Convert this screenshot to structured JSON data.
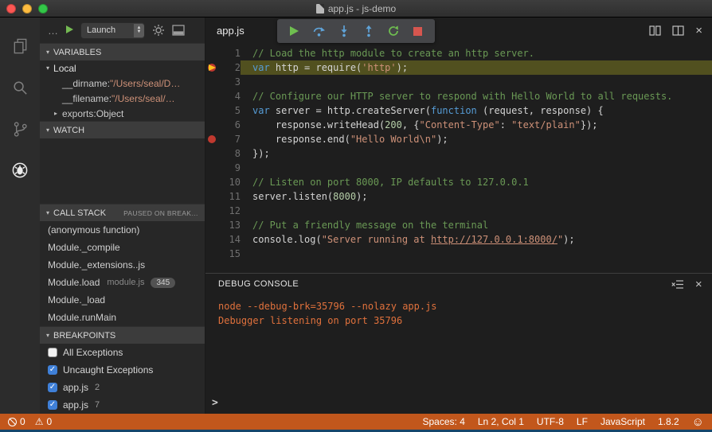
{
  "icons": {
    "close": "×",
    "warning": "⚠",
    "smiley": "☺",
    "twisty_open": "▾",
    "twisty_closed": "▸",
    "check": "✓",
    "select_up": "▲",
    "select_down": "▼"
  },
  "colors": {
    "status_bar": "#c2571c",
    "breakpoint_red": "#c0392f",
    "debug_line_highlight": "#51501f",
    "console_text": "#e0713c"
  },
  "window": {
    "title": "app.js - js-demo"
  },
  "sidebar": {
    "toolbar": {
      "overflow": "…",
      "config": "Launch"
    },
    "variables": {
      "header": "VARIABLES",
      "scope": "Local",
      "items": [
        {
          "name": "__dirname",
          "value": "\"/Users/seal/D…",
          "type": "string",
          "expand": "none"
        },
        {
          "name": "__filename",
          "value": "\"/Users/seal/…",
          "type": "string",
          "expand": "none"
        },
        {
          "name": "exports",
          "value": "Object",
          "type": "object",
          "expand": "collapsed"
        }
      ]
    },
    "watch": {
      "header": "WATCH"
    },
    "call_stack": {
      "header": "CALL STACK",
      "status": "PAUSED ON BREAK…",
      "frames": [
        {
          "label": "(anonymous function)"
        },
        {
          "label": "Module._compile"
        },
        {
          "label": "Module._extensions..js"
        },
        {
          "label": "Module.load",
          "detail": "module.js",
          "badge": "345"
        },
        {
          "label": "Module._load"
        },
        {
          "label": "Module.runMain"
        }
      ]
    },
    "breakpoints": {
      "header": "BREAKPOINTS",
      "items": [
        {
          "label": "All Exceptions",
          "checked": false
        },
        {
          "label": "Uncaught Exceptions",
          "checked": true
        },
        {
          "label": "app.js",
          "detail": "2",
          "checked": true
        },
        {
          "label": "app.js",
          "detail": "7",
          "checked": true
        }
      ]
    }
  },
  "editor": {
    "tab": "app.js",
    "code": {
      "lines": [
        {
          "n": 1,
          "tokens": [
            [
              "c",
              "// Load the http module to create an http server."
            ]
          ]
        },
        {
          "n": 2,
          "current": true,
          "breakpoint": "active",
          "tokens": [
            [
              "k",
              "var"
            ],
            [
              "p",
              " http = require("
            ],
            [
              "s",
              "'http'"
            ],
            [
              "p",
              ");"
            ]
          ]
        },
        {
          "n": 3,
          "tokens": []
        },
        {
          "n": 4,
          "tokens": [
            [
              "c",
              "// Configure our HTTP server to respond with Hello World to all requests."
            ]
          ]
        },
        {
          "n": 5,
          "tokens": [
            [
              "k",
              "var"
            ],
            [
              "p",
              " server = http.createServer("
            ],
            [
              "k",
              "function"
            ],
            [
              "p",
              " (request, response) {"
            ]
          ]
        },
        {
          "n": 6,
          "tokens": [
            [
              "p",
              "    response.writeHead("
            ],
            [
              "n",
              "200"
            ],
            [
              "p",
              ", {"
            ],
            [
              "s",
              "\"Content-Type\""
            ],
            [
              "p",
              ": "
            ],
            [
              "s",
              "\"text/plain\""
            ],
            [
              "p",
              "});"
            ]
          ]
        },
        {
          "n": 7,
          "breakpoint": "dot",
          "tokens": [
            [
              "p",
              "    response.end("
            ],
            [
              "s",
              "\"Hello World\\n\""
            ],
            [
              "p",
              ");"
            ]
          ]
        },
        {
          "n": 8,
          "tokens": [
            [
              "p",
              "});"
            ]
          ]
        },
        {
          "n": 9,
          "tokens": []
        },
        {
          "n": 10,
          "tokens": [
            [
              "c",
              "// Listen on port 8000, IP defaults to 127.0.0.1"
            ]
          ]
        },
        {
          "n": 11,
          "tokens": [
            [
              "p",
              "server.listen("
            ],
            [
              "n",
              "8000"
            ],
            [
              "p",
              ");"
            ]
          ]
        },
        {
          "n": 12,
          "tokens": []
        },
        {
          "n": 13,
          "tokens": [
            [
              "c",
              "// Put a friendly message on the terminal"
            ]
          ]
        },
        {
          "n": 14,
          "tokens": [
            [
              "p",
              "console.log("
            ],
            [
              "s",
              "\"Server running at "
            ],
            [
              "l",
              "http://127.0.0.1:8000/"
            ],
            [
              "s",
              "\""
            ],
            [
              "p",
              ");"
            ]
          ]
        },
        {
          "n": 15,
          "tokens": []
        }
      ]
    }
  },
  "debug_console": {
    "title": "DEBUG CONSOLE",
    "lines": [
      "node --debug-brk=35796 --nolazy app.js",
      "Debugger listening on port 35796"
    ],
    "prompt": ">"
  },
  "status_bar": {
    "errors": "0",
    "warnings": "0",
    "items": [
      "Spaces: 4",
      "Ln 2, Col 1",
      "UTF-8",
      "LF",
      "JavaScript",
      "1.8.2"
    ]
  }
}
